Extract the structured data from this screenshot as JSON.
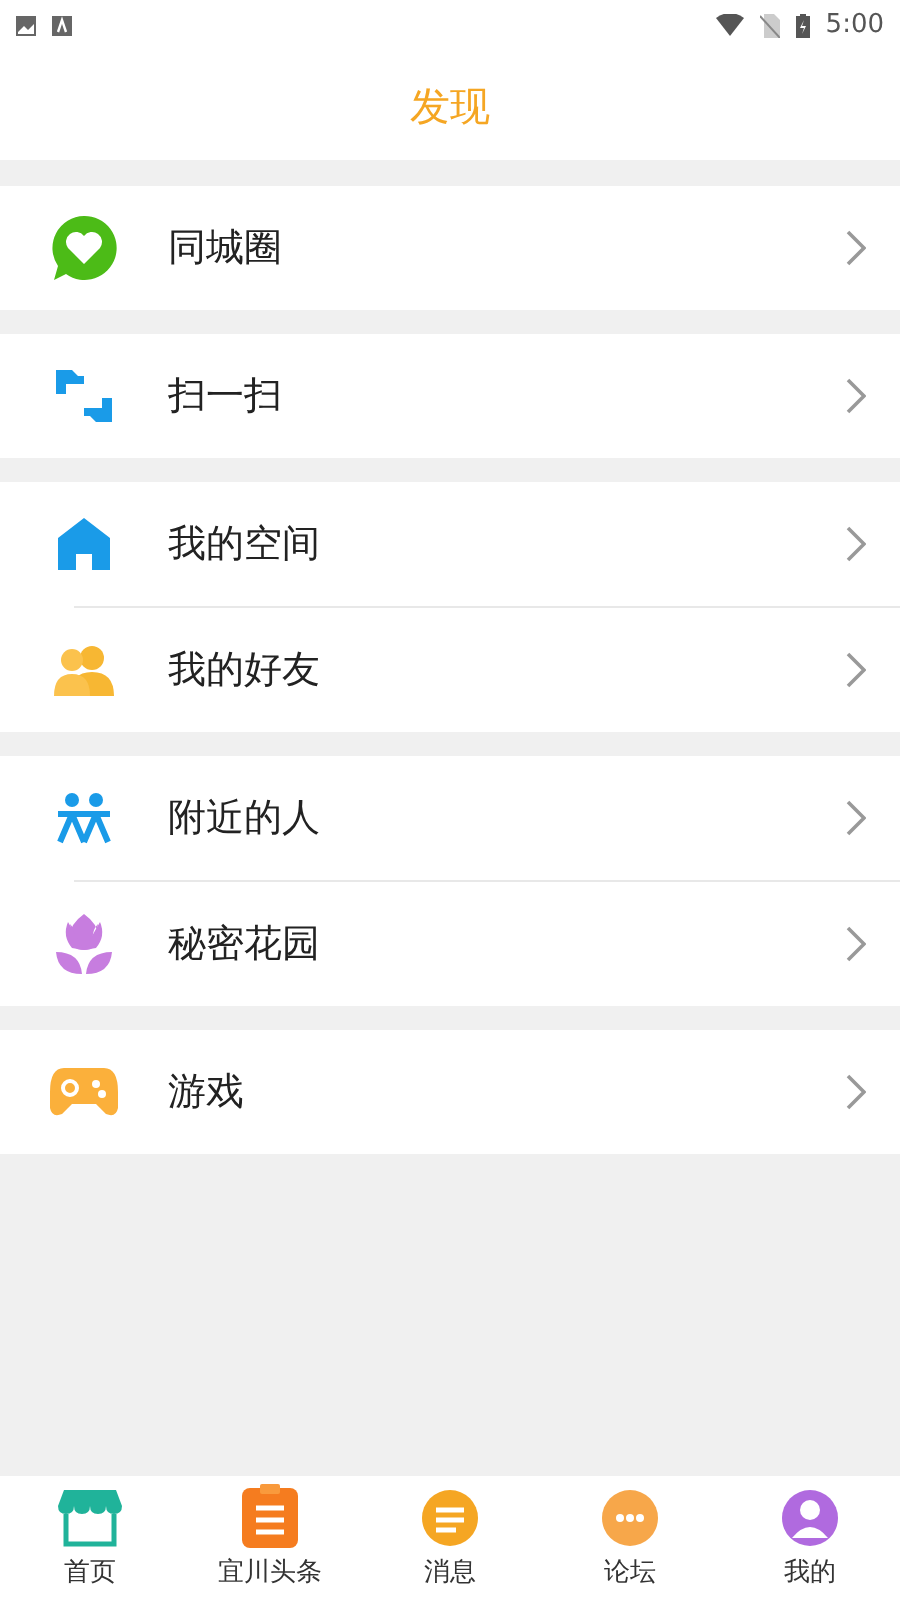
{
  "status_bar": {
    "time": "5:00"
  },
  "header": {
    "title": "发现"
  },
  "groups": [
    {
      "items": [
        {
          "label": "同城圈"
        }
      ]
    },
    {
      "items": [
        {
          "label": "扫一扫"
        }
      ]
    },
    {
      "items": [
        {
          "label": "我的空间"
        },
        {
          "label": "我的好友"
        }
      ]
    },
    {
      "items": [
        {
          "label": "附近的人"
        },
        {
          "label": "秘密花园"
        }
      ]
    },
    {
      "items": [
        {
          "label": "游戏"
        }
      ]
    }
  ],
  "tab_bar": [
    {
      "label": "首页",
      "selected": false
    },
    {
      "label": "宜川头条",
      "selected": false
    },
    {
      "label": "消息",
      "selected": false
    },
    {
      "label": "论坛",
      "selected": false
    },
    {
      "label": "我的",
      "selected": false
    }
  ]
}
